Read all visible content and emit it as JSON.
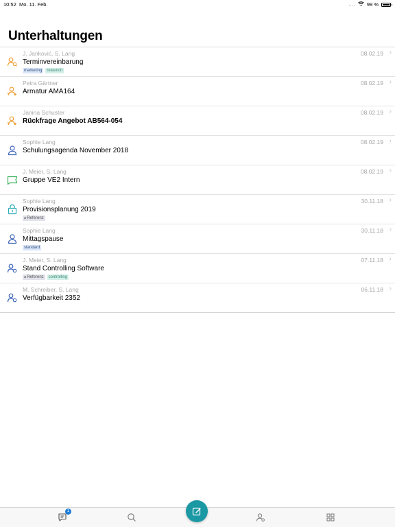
{
  "status_bar": {
    "time": "10:52",
    "date": "Mo. 11. Feb.",
    "signal": "....",
    "battery_label": "99 %",
    "battery_level": 0.99
  },
  "page": {
    "title": "Unterhaltungen"
  },
  "colors": {
    "accent": "#1a98a3",
    "orange_icon": "#f0a23a",
    "blue_icon": "#3a63b8",
    "green_icon": "#3bb15c",
    "teal_icon": "#2aa8b6",
    "badge": "#1f7ed6"
  },
  "conversations": [
    {
      "participants": "J. Janković, S. Lang",
      "title": "Terminvereinbarung",
      "date": "08.02.19",
      "icon": "group-orange-icon",
      "tags": [
        {
          "label": "marketing",
          "style": "blue"
        },
        {
          "label": "relaunch",
          "style": "green"
        }
      ]
    },
    {
      "participants": "Petra Gärtner",
      "title": "Armatur AMA164",
      "date": "08.02.19",
      "icon": "contact-orange-icon",
      "tags": []
    },
    {
      "participants": "Janina Schuster",
      "title": "Rückfrage Angebot AB564-054",
      "date": "08.02.19",
      "icon": "contact-orange-icon",
      "bold": true,
      "tags": []
    },
    {
      "participants": "Sophie Lang",
      "title": "Schulungsagenda November 2018",
      "date": "08.02.19",
      "icon": "person-blue-icon",
      "tags": []
    },
    {
      "participants": "J. Meier, S. Lang",
      "title": "Gruppe VE2 Intern",
      "date": "08.02.19",
      "icon": "group-chat-green-icon",
      "tags": []
    },
    {
      "participants": "Sophie Lang",
      "title": "Provisionsplanung 2019",
      "date": "30.11.18",
      "icon": "lock-teal-icon",
      "tags": [
        {
          "label": "Referenz",
          "style": "gray",
          "icon": true
        }
      ]
    },
    {
      "participants": "Sophie Lang",
      "title": "Mittagspause",
      "date": "30.11.18",
      "icon": "person-blue-icon",
      "tags": [
        {
          "label": "standard",
          "style": "blue"
        }
      ]
    },
    {
      "participants": "J. Meier, S. Lang",
      "title": "Stand Controlling Software",
      "date": "07.11.18",
      "icon": "group-blue-icon",
      "tags": [
        {
          "label": "Referenz",
          "style": "gray",
          "icon": true
        },
        {
          "label": "controlling",
          "style": "green"
        }
      ]
    },
    {
      "participants": "M. Schreiber, S. Lang",
      "title": "Verfügbarkeit 2352",
      "date": "06.11.18",
      "icon": "group-blue-icon",
      "tags": []
    }
  ],
  "tab_bar": {
    "chats_badge": "1",
    "tabs": [
      "chats-icon",
      "search-icon",
      "compose-icon",
      "contacts-icon",
      "grid-icon"
    ]
  }
}
